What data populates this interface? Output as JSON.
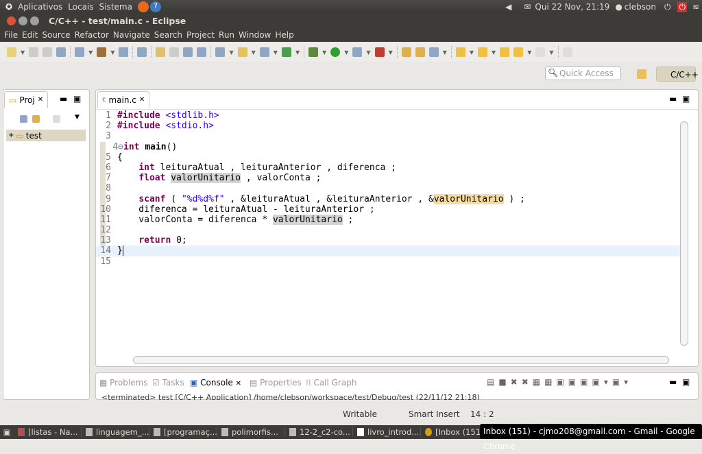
{
  "top_panel": {
    "menus": [
      "Aplicativos",
      "Locais",
      "Sistema"
    ],
    "datetime": "Qui 22 Nov, 21:19",
    "user": "clebson"
  },
  "window": {
    "title": "C/C++ - test/main.c - Eclipse"
  },
  "menubar": [
    "File",
    "Edit",
    "Source",
    "Refactor",
    "Navigate",
    "Search",
    "Project",
    "Run",
    "Window",
    "Help"
  ],
  "quick_access": {
    "placeholder": "Quick Access"
  },
  "perspective": "C/C++",
  "left_panel": {
    "tab": "Proj",
    "tree": [
      {
        "label": "test"
      }
    ]
  },
  "editor": {
    "tab": "main.c",
    "cursor_line": 14,
    "lines": [
      [
        [
          "pp",
          "#include"
        ],
        [
          "p",
          " "
        ],
        [
          "str",
          "<stdlib.h>"
        ]
      ],
      [
        [
          "pp",
          "#include"
        ],
        [
          "p",
          " "
        ],
        [
          "str",
          "<stdio.h>"
        ]
      ],
      [],
      [
        [
          "kw",
          "int"
        ],
        [
          "p",
          " "
        ],
        [
          "b",
          "main"
        ],
        [
          "p",
          "()"
        ]
      ],
      [
        [
          "p",
          "{"
        ]
      ],
      [
        [
          "p",
          "    "
        ],
        [
          "kw",
          "int"
        ],
        [
          "p",
          " leituraAtual , leituraAnterior , diferenca ;"
        ]
      ],
      [
        [
          "p",
          "    "
        ],
        [
          "kw",
          "float"
        ],
        [
          "p",
          " "
        ],
        [
          "hl",
          "valorUnitario"
        ],
        [
          "p",
          " , valorConta ;"
        ]
      ],
      [],
      [
        [
          "p",
          "    "
        ],
        [
          "kw",
          "scanf"
        ],
        [
          "p",
          " ( "
        ],
        [
          "str",
          "\"%d%d%f\""
        ],
        [
          "p",
          " , &leituraAtual , &leituraAnterior , &"
        ],
        [
          "hlw",
          "valorUnitario"
        ],
        [
          "p",
          " ) ;"
        ]
      ],
      [
        [
          "p",
          "    diferenca = leituraAtual - leituraAnterior ;"
        ]
      ],
      [
        [
          "p",
          "    valorConta = diferenca * "
        ],
        [
          "hl",
          "valorUnitario"
        ],
        [
          "p",
          " ;"
        ]
      ],
      [],
      [
        [
          "p",
          "    "
        ],
        [
          "kw",
          "return"
        ],
        [
          "p",
          " 0;"
        ]
      ],
      [
        [
          "p",
          "}"
        ]
      ],
      []
    ]
  },
  "bottom_panel": {
    "tabs": [
      "Problems",
      "Tasks",
      "Console",
      "Properties",
      "Call Graph"
    ],
    "active": "Console",
    "console_text": "<terminated> test [C/C++ Application] /home/clebson/workspace/test/Debug/test (22/11/12 21:18)"
  },
  "status": {
    "writable": "Writable",
    "insert_mode": "Smart Insert",
    "position": "14 : 2"
  },
  "taskbar": [
    "[listas - Na...",
    "linguagem_...",
    "[programaç...",
    "polimorfis...",
    "12-2_c2-co...",
    "livro_introd...",
    "[Inbox (151"
  ],
  "tooltip": "Inbox (151) - cjmo208@gmail.com - Gmail - Google Chrome"
}
